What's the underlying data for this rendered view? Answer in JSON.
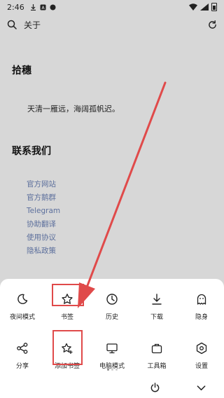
{
  "status_bar": {
    "time": "2:46"
  },
  "top_bar": {
    "title": "关于"
  },
  "about": {
    "heading": "拾穗",
    "motto": "天清一雁远，海阔孤帆迟。"
  },
  "contact": {
    "heading": "联系我们",
    "links": [
      "官方网站",
      "官方鹅群",
      "Telegram",
      "协助翻译",
      "使用协议",
      "隐私政策"
    ]
  },
  "menu": {
    "row1": [
      {
        "label": "夜间模式",
        "icon": "moon-icon"
      },
      {
        "label": "书签",
        "icon": "star-icon"
      },
      {
        "label": "历史",
        "icon": "clock-icon"
      },
      {
        "label": "下载",
        "icon": "download-icon"
      },
      {
        "label": "隐身",
        "icon": "ghost-icon"
      }
    ],
    "row2": [
      {
        "label": "分享",
        "icon": "share-icon"
      },
      {
        "label": "添加书签",
        "icon": "star-add-icon"
      },
      {
        "label": "电脑模式",
        "icon": "monitor-icon"
      },
      {
        "label": "工具箱",
        "icon": "toolbox-icon"
      },
      {
        "label": "设置",
        "icon": "gear-icon"
      }
    ],
    "page_count": 3,
    "current_page": 1
  },
  "colors": {
    "accent_link": "#5c6f9c",
    "highlight": "#e04a4a",
    "backdrop": "#d7d7d7"
  }
}
